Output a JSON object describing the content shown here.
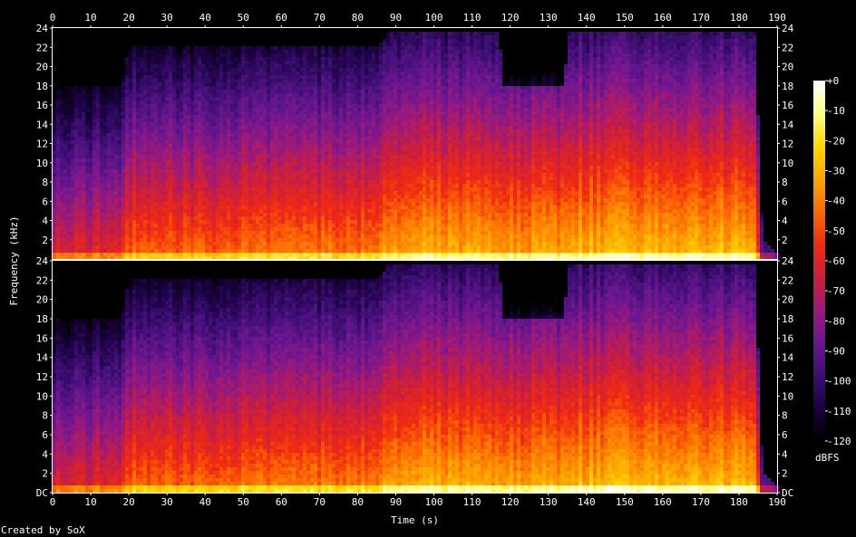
{
  "chart_data": {
    "type": "heatmap",
    "xlabel": "Time (s)",
    "ylabel": "Frequency (kHz)",
    "x_ticks": [
      0,
      10,
      20,
      30,
      40,
      50,
      60,
      70,
      80,
      90,
      100,
      110,
      120,
      130,
      140,
      150,
      160,
      170,
      180,
      190
    ],
    "xlim": [
      0,
      190
    ],
    "channels": [
      {
        "y_ticks": [
          "2",
          "4",
          "6",
          "8",
          "10",
          "12",
          "14",
          "16",
          "18",
          "20",
          "22",
          "24"
        ],
        "ylim": [
          0,
          24
        ]
      },
      {
        "y_ticks": [
          "DC",
          "2",
          "4",
          "6",
          "8",
          "10",
          "12",
          "14",
          "16",
          "18",
          "20",
          "22",
          "24"
        ],
        "ylim": [
          0,
          24
        ]
      }
    ],
    "colorbar": {
      "unit": "dBFS",
      "ticks": [
        "+0",
        "-10",
        "-20",
        "-30",
        "-40",
        "-50",
        "-60",
        "-70",
        "-80",
        "-90",
        "-100",
        "-110",
        "-120"
      ],
      "range": [
        -120,
        0
      ],
      "colors": [
        "#000000",
        "#1a0040",
        "#3d0f73",
        "#6a1690",
        "#9a1a7a",
        "#cc1f3a",
        "#ef2a12",
        "#fb6a00",
        "#ffa400",
        "#ffd800",
        "#ffff80",
        "#ffffff"
      ]
    },
    "energy_profile": {
      "description_free_values": true,
      "time_s": [
        0,
        18,
        20,
        85,
        88,
        117,
        118,
        134,
        135,
        184,
        186,
        190
      ],
      "upper_cutoff_khz": [
        18,
        18,
        22,
        22,
        23.5,
        23.5,
        18,
        18,
        23.5,
        23.5,
        2,
        0.5
      ],
      "level_dbfs": [
        -78,
        -75,
        -62,
        -58,
        -48,
        -46,
        -50,
        -49,
        -45,
        -44,
        -110,
        -120
      ]
    }
  },
  "credit": "Created by SoX"
}
